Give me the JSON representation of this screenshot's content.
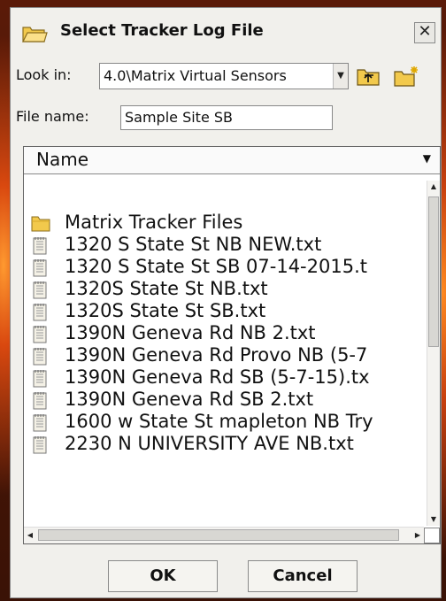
{
  "dialog": {
    "title": "Select Tracker Log File",
    "close_label": "✕"
  },
  "look_in": {
    "label": "Look in:",
    "value": "4.0\\Matrix Virtual Sensors"
  },
  "file_name": {
    "label": "File name:",
    "value": "Sample Site SB"
  },
  "list": {
    "column_header": "Name",
    "items": [
      {
        "type": "folder",
        "label": "Matrix Tracker Files"
      },
      {
        "type": "file",
        "label": "1320 S State St NB NEW.txt"
      },
      {
        "type": "file",
        "label": "1320 S State St SB 07-14-2015.t"
      },
      {
        "type": "file",
        "label": "1320S State St NB.txt"
      },
      {
        "type": "file",
        "label": "1320S State St SB.txt"
      },
      {
        "type": "file",
        "label": "1390N Geneva Rd NB 2.txt"
      },
      {
        "type": "file",
        "label": "1390N Geneva Rd Provo NB (5-7"
      },
      {
        "type": "file",
        "label": "1390N Geneva Rd SB (5-7-15).tx"
      },
      {
        "type": "file",
        "label": "1390N Geneva Rd SB 2.txt"
      },
      {
        "type": "file",
        "label": "1600 w State St mapleton NB Try"
      },
      {
        "type": "file",
        "label": "2230 N UNIVERSITY AVE NB.txt"
      }
    ]
  },
  "buttons": {
    "ok": "OK",
    "cancel": "Cancel"
  },
  "colors": {
    "dialog_bg": "#f1f0ec",
    "folder_yellow": "#f2c94c",
    "backdrop": "#3a1206"
  }
}
